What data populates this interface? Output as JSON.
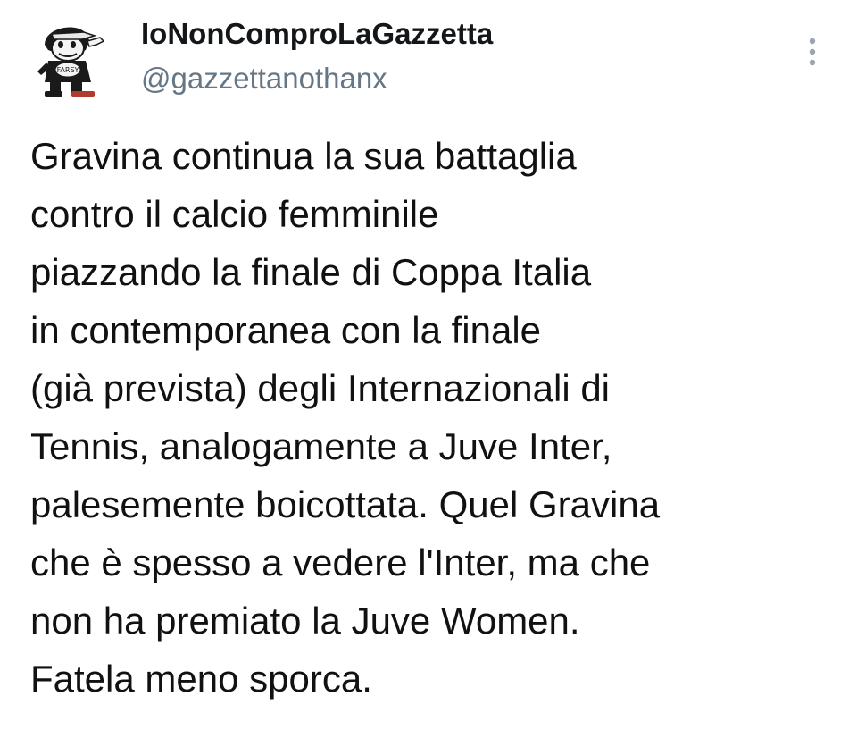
{
  "tweet": {
    "author": {
      "display_name": "IoNonComproLaGazzetta",
      "handle": "@gazzettanothanx",
      "avatar_icon": "cartoon-avatar-icon",
      "avatar_badge_text": "FARSY"
    },
    "more_icon": "vertical-ellipsis-icon",
    "text_lines": [
      "Gravina continua la sua battaglia",
      "contro il calcio femminile",
      "piazzando la finale di Coppa Italia",
      "in contemporanea con la finale",
      "(già prevista) degli Internazionali di",
      "Tennis, analogamente a Juve Inter,",
      "palesemente boicottata. Quel Gravina",
      "che è spesso a vedere l'Inter, ma che",
      "non ha premiato la Juve Women.",
      "Fatela meno sporca."
    ]
  },
  "colors": {
    "name": "#14171a",
    "handle": "#657786",
    "text": "#111111",
    "icon": "#9aa5b0"
  }
}
